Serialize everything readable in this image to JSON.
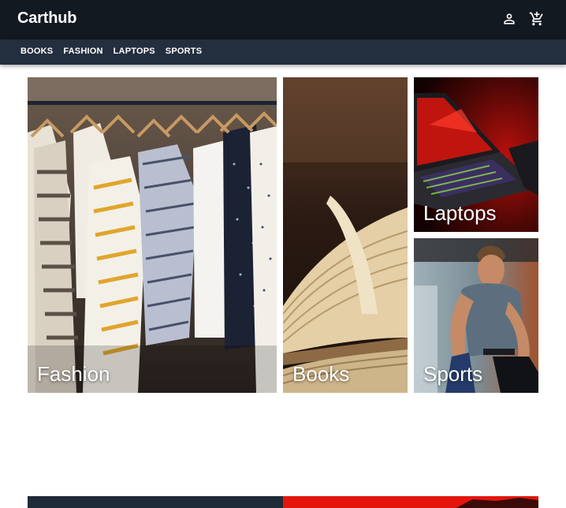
{
  "header": {
    "brand": "Carthub",
    "icons": [
      "account-icon",
      "cart-icon"
    ]
  },
  "nav": {
    "items": [
      {
        "label": "BOOKS"
      },
      {
        "label": "FASHION"
      },
      {
        "label": "LAPTOPS"
      },
      {
        "label": "SPORTS"
      }
    ]
  },
  "tiles": {
    "fashion": {
      "label": "Fashion"
    },
    "books": {
      "label": "Books"
    },
    "laptops": {
      "label": "Laptops"
    },
    "sports": {
      "label": "Sports"
    }
  },
  "colors": {
    "topbar": "#131921",
    "catbar": "#232f3e",
    "banner_left": "#1f2a38",
    "banner_right": "#e4150c"
  }
}
